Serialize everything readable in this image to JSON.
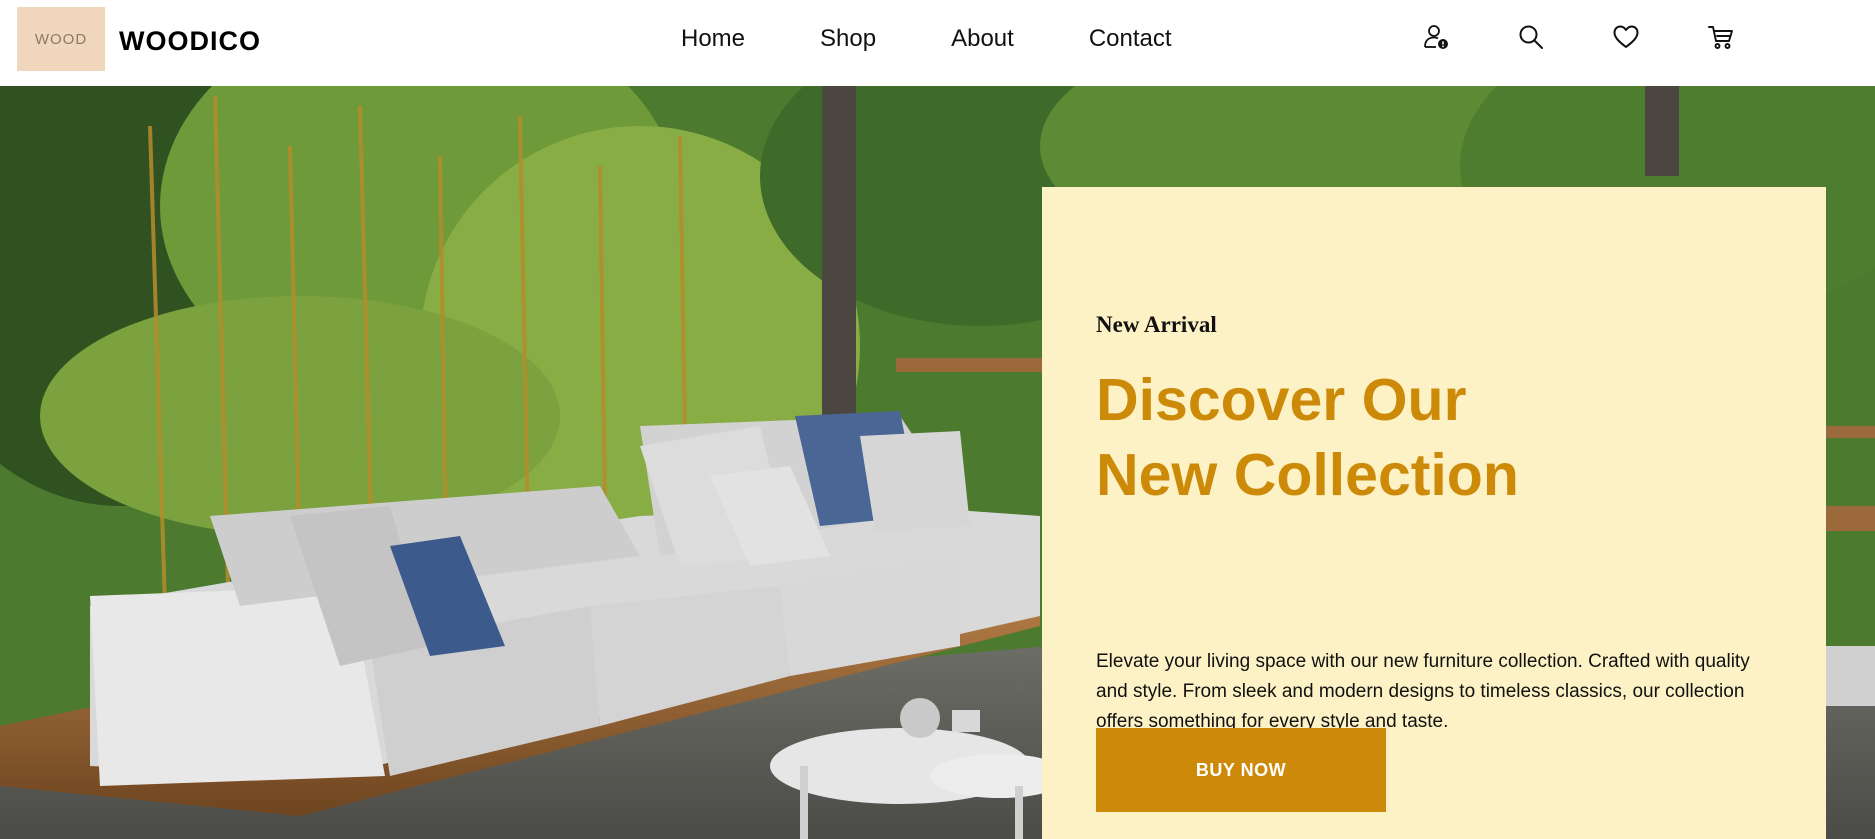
{
  "header": {
    "logo_text": "WOOD",
    "brand_name": "WOODICO",
    "nav": [
      {
        "label": "Home"
      },
      {
        "label": "Shop"
      },
      {
        "label": "About"
      },
      {
        "label": "Contact"
      }
    ],
    "icons": [
      "user-alert-icon",
      "search-icon",
      "heart-icon",
      "cart-icon"
    ]
  },
  "hero": {
    "eyebrow": "New Arrival",
    "headline_line1": "Discover Our",
    "headline_line2": "New Collection",
    "description": "Elevate your living space with our new furniture collection. Crafted with quality and style. From sleek and modern designs to timeless classics, our collection offers something for every style and taste.",
    "cta_label": "BUY NOW"
  },
  "colors": {
    "accent": "#cd8a08",
    "card_bg": "#fdf2c5",
    "logo_bg": "#efd6bd"
  }
}
